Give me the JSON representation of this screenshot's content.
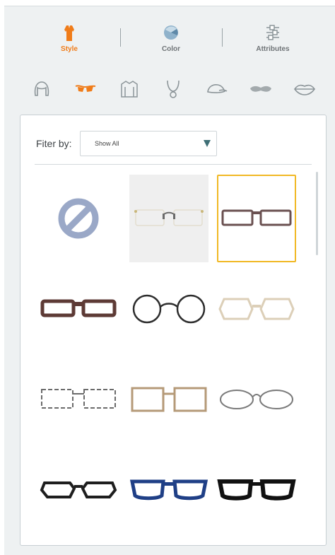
{
  "tabs": [
    {
      "label": "Style",
      "icon": "dress-icon",
      "active": true
    },
    {
      "label": "Color",
      "icon": "color-swatch-icon",
      "active": false
    },
    {
      "label": "Attributes",
      "icon": "sliders-icon",
      "active": false
    }
  ],
  "categories": [
    {
      "name": "hair",
      "icon": "hair-icon",
      "active": false
    },
    {
      "name": "glasses",
      "icon": "glasses-icon",
      "active": true
    },
    {
      "name": "top",
      "icon": "shirt-icon",
      "active": false
    },
    {
      "name": "necklace",
      "icon": "necklace-icon",
      "active": false
    },
    {
      "name": "hat",
      "icon": "cap-icon",
      "active": false
    },
    {
      "name": "mustache",
      "icon": "mustache-icon",
      "active": false
    },
    {
      "name": "lips",
      "icon": "lips-icon",
      "active": false
    }
  ],
  "filter": {
    "label": "Fiter by:",
    "selected": "Show All"
  },
  "colors": {
    "accent": "#f07c19",
    "selected_border": "#f1b824",
    "none_icon": "#9aa8c7"
  },
  "items": [
    {
      "name": "none",
      "style": "none"
    },
    {
      "name": "rimless-gold",
      "style": "rimless"
    },
    {
      "name": "rect-brown-thin",
      "style": "rect-thin",
      "selected": true
    },
    {
      "name": "rect-brown-thick",
      "style": "rect-thick"
    },
    {
      "name": "round-wire-black",
      "style": "round"
    },
    {
      "name": "hex-cream",
      "style": "hex"
    },
    {
      "name": "rect-dashed-grey",
      "style": "rect-dashed"
    },
    {
      "name": "square-tan",
      "style": "square"
    },
    {
      "name": "oval-grey",
      "style": "oval"
    },
    {
      "name": "oval-black-thick",
      "style": "oval-thick"
    },
    {
      "name": "cateye-navy",
      "style": "cateye"
    },
    {
      "name": "bold-black",
      "style": "bold"
    }
  ]
}
